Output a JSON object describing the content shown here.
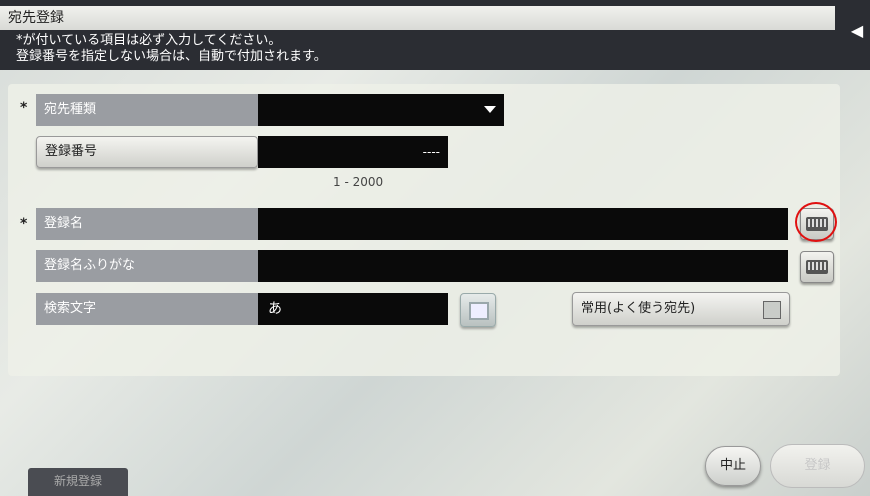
{
  "header": {
    "title": "宛先登録",
    "notice_line1": "*が付いている項目は必ず入力してください。",
    "notice_line2": "登録番号を指定しない場合は、自動で付加されます。"
  },
  "form": {
    "required_mark": "*",
    "destination_type": {
      "label": "宛先種類",
      "value": ""
    },
    "registration_number": {
      "label": "登録番号",
      "value": "----",
      "range": "1 - 2000"
    },
    "registration_name": {
      "label": "登録名",
      "value": ""
    },
    "name_furigana": {
      "label": "登録名ふりがな",
      "value": ""
    },
    "search_char": {
      "label": "検索文字",
      "value": "あ"
    },
    "favorite": {
      "label": "常用(よく使う宛先)",
      "checked": false
    }
  },
  "footer": {
    "new_register_tab": "新規登録",
    "cancel_label": "中止",
    "register_label": "登録"
  },
  "colors": {
    "highlight_circle": "#e01010"
  },
  "icons": [
    "keyboard-icon",
    "copy-icon",
    "back-arrow-icon",
    "dropdown-arrow-icon"
  ]
}
